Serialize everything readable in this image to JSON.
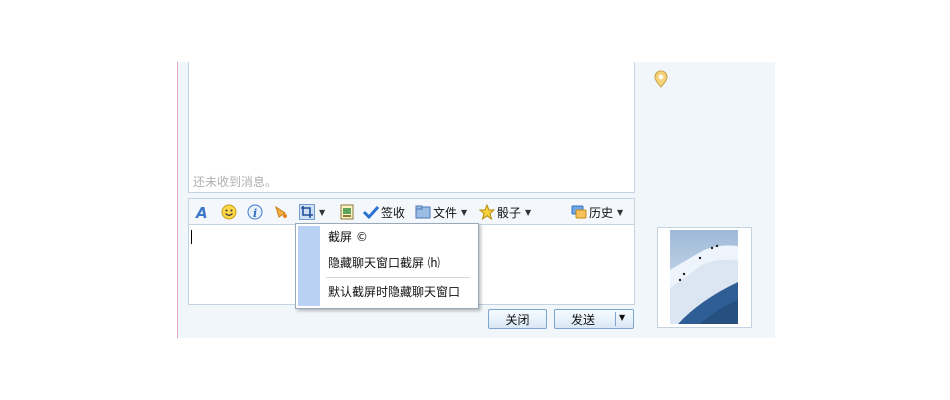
{
  "chat": {
    "empty_message": "还未收到消息。"
  },
  "toolbar": {
    "font_icon": "font-A-icon",
    "emoji_icon": "smiley-icon",
    "info_icon": "info-icon",
    "shake_icon": "shake-bell-icon",
    "screenshot_icon": "crop-screenshot-icon",
    "sign_label": "签收",
    "file_label": "文件",
    "dice_label": "骰子",
    "history_label": "历史"
  },
  "screenshot_menu": {
    "items": [
      "截屏 ©",
      "隐藏聊天窗口截屏 ⒣",
      "默认截屏时隐藏聊天窗口"
    ]
  },
  "buttons": {
    "close_label": "关闭",
    "send_label": "发送"
  },
  "colors": {
    "window_bg": "#f1f6fa",
    "border": "#c3d3e2",
    "menu_strip": "#b9d1f2",
    "accent_blue": "#2f6fc1"
  }
}
